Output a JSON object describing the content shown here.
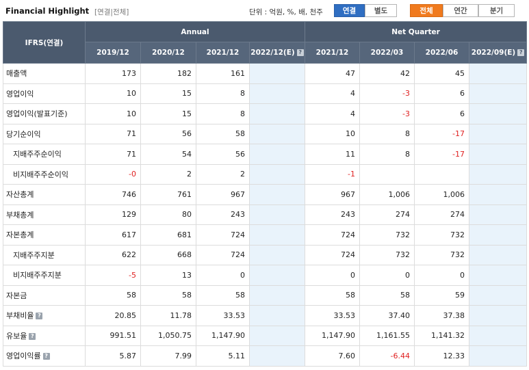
{
  "header": {
    "title": "Financial Highlight",
    "subtitle": "[연결|전체]",
    "unit": "단위 : 억원, %, 배, 천주",
    "toggle1": [
      "연결",
      "별도"
    ],
    "toggle2": [
      "전체",
      "연간",
      "분기"
    ]
  },
  "table": {
    "corner": "IFRS(연결)",
    "group_annual": "Annual",
    "group_quarter": "Net Quarter",
    "columns": [
      "2019/12",
      "2020/12",
      "2021/12",
      "2022/12(E)",
      "2021/12",
      "2022/03",
      "2022/06",
      "2022/09(E)"
    ],
    "rows": [
      {
        "label": "매출액",
        "sub": false,
        "help": false,
        "cells": [
          "173",
          "182",
          "161",
          "",
          "47",
          "42",
          "45",
          ""
        ]
      },
      {
        "label": "영업이익",
        "sub": false,
        "help": false,
        "cells": [
          "10",
          "15",
          "8",
          "",
          "4",
          "-3",
          "6",
          ""
        ]
      },
      {
        "label": "영업이익(발표기준)",
        "sub": false,
        "help": false,
        "cells": [
          "10",
          "15",
          "8",
          "",
          "4",
          "-3",
          "6",
          ""
        ]
      },
      {
        "label": "당기순이익",
        "sub": false,
        "help": false,
        "cells": [
          "71",
          "56",
          "58",
          "",
          "10",
          "8",
          "-17",
          ""
        ]
      },
      {
        "label": "지배주주순이익",
        "sub": true,
        "help": false,
        "cells": [
          "71",
          "54",
          "56",
          "",
          "11",
          "8",
          "-17",
          ""
        ]
      },
      {
        "label": "비지배주주순이익",
        "sub": true,
        "help": false,
        "cells": [
          "-0",
          "2",
          "2",
          "",
          "-1",
          "",
          "",
          ""
        ]
      },
      {
        "label": "자산총계",
        "sub": false,
        "help": false,
        "cells": [
          "746",
          "761",
          "967",
          "",
          "967",
          "1,006",
          "1,006",
          ""
        ]
      },
      {
        "label": "부채총계",
        "sub": false,
        "help": false,
        "cells": [
          "129",
          "80",
          "243",
          "",
          "243",
          "274",
          "274",
          ""
        ]
      },
      {
        "label": "자본총계",
        "sub": false,
        "help": false,
        "cells": [
          "617",
          "681",
          "724",
          "",
          "724",
          "732",
          "732",
          ""
        ]
      },
      {
        "label": "지배주주지분",
        "sub": true,
        "help": false,
        "cells": [
          "622",
          "668",
          "724",
          "",
          "724",
          "732",
          "732",
          ""
        ]
      },
      {
        "label": "비지배주주지분",
        "sub": true,
        "help": false,
        "cells": [
          "-5",
          "13",
          "0",
          "",
          "0",
          "0",
          "0",
          ""
        ]
      },
      {
        "label": "자본금",
        "sub": false,
        "help": false,
        "cells": [
          "58",
          "58",
          "58",
          "",
          "58",
          "58",
          "59",
          ""
        ]
      },
      {
        "label": "부채비율",
        "sub": false,
        "help": true,
        "cells": [
          "20.85",
          "11.78",
          "33.53",
          "",
          "33.53",
          "37.40",
          "37.38",
          ""
        ]
      },
      {
        "label": "유보율",
        "sub": false,
        "help": true,
        "cells": [
          "991.51",
          "1,050.75",
          "1,147.90",
          "",
          "1,147.90",
          "1,161.55",
          "1,141.32",
          ""
        ]
      },
      {
        "label": "영업이익률",
        "sub": false,
        "help": true,
        "cells": [
          "5.87",
          "7.99",
          "5.11",
          "",
          "7.60",
          "-6.44",
          "12.33",
          ""
        ]
      }
    ]
  }
}
